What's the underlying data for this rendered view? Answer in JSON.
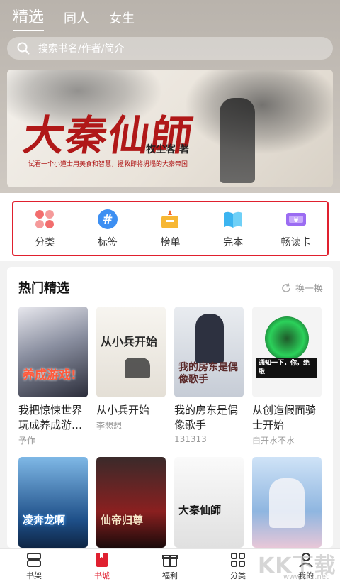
{
  "header": {
    "tabs": [
      {
        "label": "精选",
        "active": true
      },
      {
        "label": "同人",
        "active": false
      },
      {
        "label": "女生",
        "active": false
      }
    ]
  },
  "search": {
    "placeholder": "搜索书名/作者/简介"
  },
  "banner": {
    "title": "大秦仙師",
    "author": "牧尘客",
    "author_suffix": "著",
    "slogan": "试看一个小道士用美食和智慧，拯救即将坍塌的大秦帝国"
  },
  "categories": [
    {
      "label": "分类",
      "icon": "grid-petals-icon"
    },
    {
      "label": "标签",
      "icon": "hashtag-icon"
    },
    {
      "label": "榜单",
      "icon": "trophy-icon"
    },
    {
      "label": "完本",
      "icon": "book-icon"
    },
    {
      "label": "畅读卡",
      "icon": "ticket-icon"
    }
  ],
  "hot": {
    "title": "热门精选",
    "refresh_label": "换一换",
    "books": [
      {
        "title_line1": "我把惊悚世界",
        "title_line2": "玩成养成游…",
        "author": "予作",
        "cover_text": "养成游戏!"
      },
      {
        "title_line1": "从小兵开始",
        "title_line2": "",
        "author": "李想想",
        "cover_text": "从小兵开始"
      },
      {
        "title_line1": "我的房东是偶",
        "title_line2": "像歌手",
        "author": "131313",
        "cover_text": "我的房东是偶像歌手"
      },
      {
        "title_line1": "从创造假面骑",
        "title_line2": "士开始",
        "author": "白开水不水",
        "cover_text": "通知一下，你，绝版"
      },
      {
        "cover_text": "凌奔龙啊"
      },
      {
        "cover_text": "仙帝归尊"
      },
      {
        "cover_text": "大秦仙師"
      },
      {
        "cover_text": ""
      }
    ]
  },
  "bottom_nav": [
    {
      "label": "书架",
      "icon": "bookshelf-icon",
      "active": false
    },
    {
      "label": "书城",
      "icon": "bookstore-icon",
      "active": true
    },
    {
      "label": "福利",
      "icon": "gift-icon",
      "active": false
    },
    {
      "label": "分类",
      "icon": "category-grid-icon",
      "active": false
    },
    {
      "label": "我的",
      "icon": "profile-icon",
      "active": false
    }
  ],
  "watermark": {
    "text": "KK下载",
    "site": "www.kkx.net"
  },
  "colors": {
    "accent": "#e02030",
    "highlight_border": "#e0202e"
  }
}
